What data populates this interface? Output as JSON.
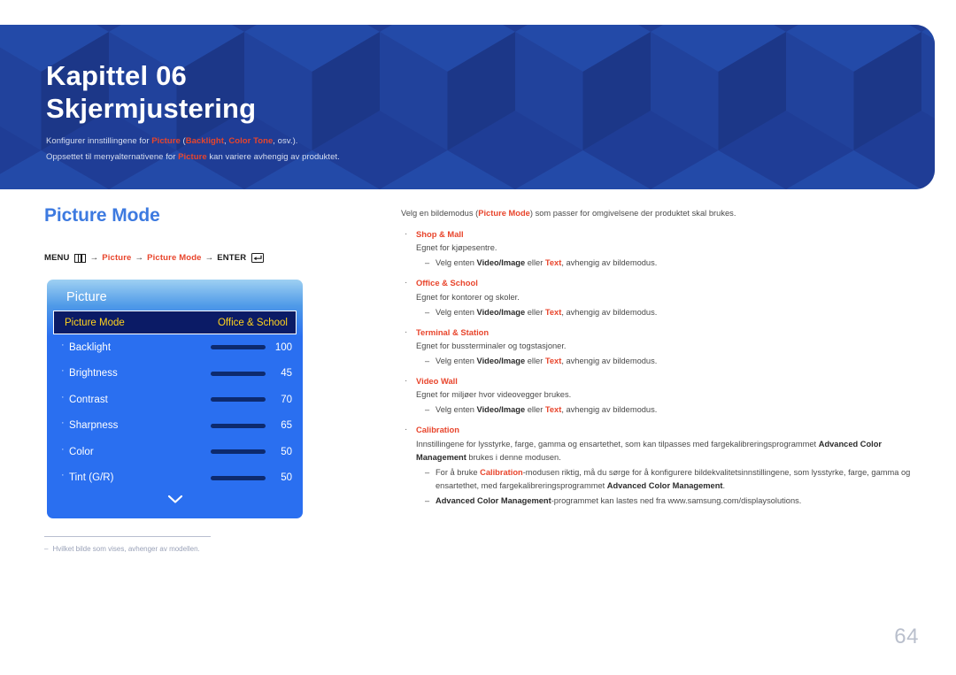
{
  "banner": {
    "chapter": "Kapittel 06",
    "title": "Skjermjustering",
    "sub1_a": "Konfigurer innstillingene for ",
    "sub1_b": "Picture",
    "sub1_c": " (",
    "sub1_d": "Backlight",
    "sub1_e": ", ",
    "sub1_f": "Color Tone",
    "sub1_g": ", osv.).",
    "sub2_a": "Oppsettet til menyalternativene for ",
    "sub2_b": "Picture",
    "sub2_c": " kan variere avhengig av produktet.",
    "bg_color": "#1f3d96",
    "accent_color": "#e8452c"
  },
  "section": {
    "title": "Picture Mode",
    "title_color": "#3d7ae0"
  },
  "menu_path": {
    "menu_label": "MENU",
    "menu_icon": "menu-bars-icon",
    "arrow": "→",
    "step1": "Picture",
    "step2": "Picture Mode",
    "enter_label": "ENTER",
    "enter_icon": "enter-return-icon"
  },
  "osd": {
    "title": "Picture",
    "selected": {
      "label": "Picture Mode",
      "value": "Office & School"
    },
    "rows": [
      {
        "label": "Backlight",
        "value": "100",
        "percent": 100
      },
      {
        "label": "Brightness",
        "value": "45",
        "percent": 45
      },
      {
        "label": "Contrast",
        "value": "70",
        "percent": 70
      },
      {
        "label": "Sharpness",
        "value": "65",
        "percent": 65
      },
      {
        "label": "Color",
        "value": "50",
        "percent": 50
      },
      {
        "label": "Tint (G/R)",
        "value": "50",
        "percent": 50
      }
    ],
    "scroll_icon": "chevron-down-icon",
    "highlight_bg": "#0b1b66",
    "highlight_text": "#ffd21e",
    "slider_fill": "#87ecd8",
    "slider_track": "#0d2a6e"
  },
  "footnote": {
    "dash": "–",
    "text": "Hvilket bilde som vises, avhenger av modellen."
  },
  "content": {
    "intro_a": "Velg en bildemodus (",
    "intro_b": "Picture Mode",
    "intro_c": ") som passer for omgivelsene der produktet skal brukes.",
    "sub_prefix": "Velg enten ",
    "sub_opt1": "Video/Image",
    "sub_mid": " eller ",
    "sub_opt2": "Text",
    "sub_suffix": ", avhengig av bildemodus.",
    "items": [
      {
        "head": "Shop & Mall",
        "desc": "Egnet for kjøpesentre."
      },
      {
        "head": "Office & School",
        "desc": "Egnet for kontorer og skoler."
      },
      {
        "head": "Terminal & Station",
        "desc": "Egnet for bussterminaler og togstasjoner."
      },
      {
        "head": "Video Wall",
        "desc": "Egnet for miljøer hvor videovegger brukes."
      }
    ],
    "calibration": {
      "head": "Calibration",
      "para_a": "Innstillingene for lysstyrke, farge, gamma og ensartethet, som kan tilpasses med fargekalibreringsprogrammet ",
      "para_b": "Advanced Color Management",
      "para_c": " brukes i denne modusen.",
      "sub1_a": "For å bruke ",
      "sub1_b": "Calibration",
      "sub1_c": "-modusen riktig, må du sørge for å konfigurere bildekvalitetsinnstillingene, som lysstyrke, farge, gamma og ensartethet, med fargekalibreringsprogrammet ",
      "sub1_d": "Advanced Color Management",
      "sub1_e": ".",
      "sub2_a": "Advanced Color Management",
      "sub2_b": "-programmet kan lastes ned fra www.samsung.com/displaysolutions."
    }
  },
  "page_number": "64"
}
